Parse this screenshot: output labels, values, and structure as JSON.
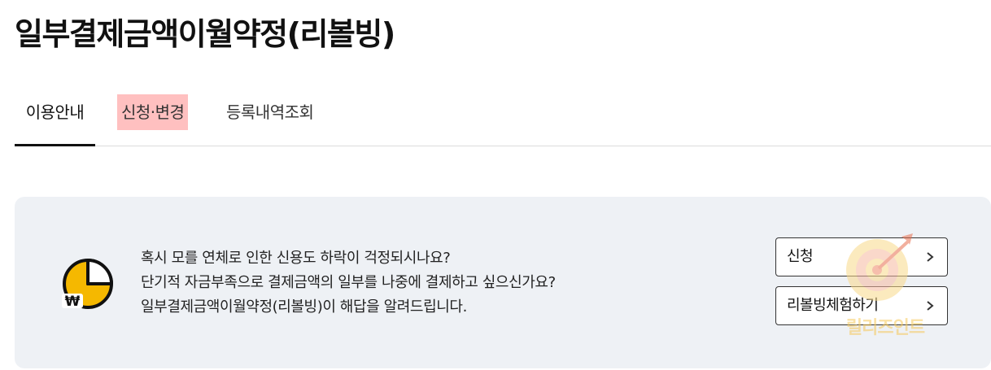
{
  "page": {
    "title": "일부결제금액이월약정(리볼빙)"
  },
  "tabs": [
    {
      "label": "이용안내",
      "active": true
    },
    {
      "label": "신청·변경",
      "highlighted": true
    },
    {
      "label": "등록내역조회"
    }
  ],
  "info": {
    "icon": "clock-won-icon",
    "lines": [
      "혹시 모를 연체로 인한 신용도 하락이 걱정되시나요?",
      "단기적 자금부족으로 결제금액의 일부를 나중에 결제하고 싶으신가요?",
      "일부결제금액이월약정(리볼빙)이 해답을 알려드립니다."
    ],
    "icon_won_glyph": "₩"
  },
  "actions": {
    "apply_label": "신청",
    "trial_label": "리볼빙체험하기"
  },
  "watermark": {
    "text": "릴리즈인트"
  },
  "colors": {
    "accent_yellow": "#f5b800",
    "tab_highlight": "#ffc0c0",
    "box_bg": "#eef1f5"
  }
}
